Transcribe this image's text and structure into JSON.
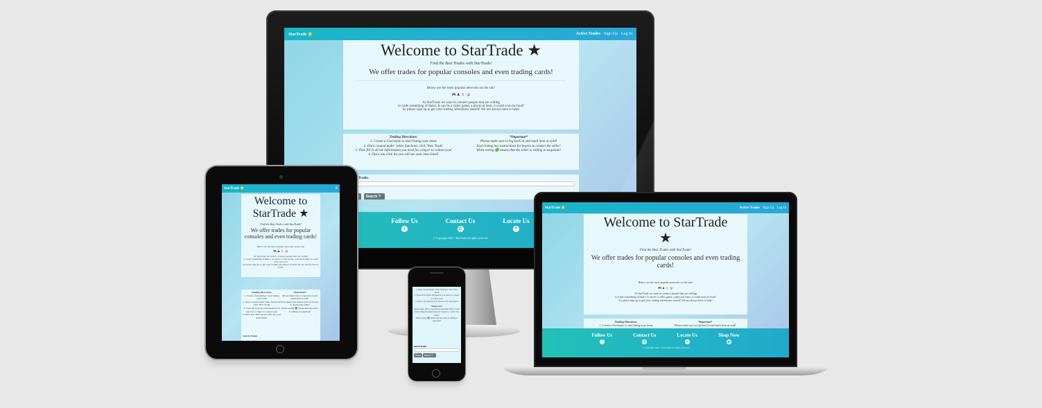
{
  "site": {
    "brand": "StarTrade ⭐",
    "nav": {
      "active_trades": "Active Trades",
      "sign_up": "Sign Up",
      "log_in": "Log In"
    },
    "welcome_title": "Welcome to StarTrade",
    "welcome_star": "★",
    "tagline": "Find the Best Trades with StarTrade!",
    "offer": "We offer trades for popular consoles and even trading cards!",
    "networks_intro": "Below are the most popular networks on the site!",
    "network_icons": "🎮 ♟ 🃏 🎲",
    "about_line1": "At StarTrade we want to connect people that are willing",
    "about_line2": "to trade something of theirs. It can be a video game, a physical item, it could even be food!",
    "about_line3": "So please sign up to get your trading adventures started! We are always here to help!",
    "directions": {
      "title": "Trading Directions:",
      "step1": "1. Create a Username to start listing your items",
      "step2": "2. Once created under 'seller functions' click 'New Trade'",
      "step3": "3. Then fill in all the information you need for a buyer to contact you!",
      "step4": "4. Once you click list you will see your item listed!"
    },
    "important": {
      "title": "*Important*",
      "line1": "Please make sure to log back in and mark item as sold!",
      "line2": "Each listing has instructions for buyers to contact the seller!",
      "line3": "When seeing 🟢 means that the seller is willing to negotiate!"
    },
    "search": {
      "label": "Search Trades",
      "reset_button": "Reset",
      "search_button": "Search 🔍"
    },
    "footer": {
      "follow_us": "Follow Us",
      "contact_us": "Contact Us",
      "locate_us": "Locate Us",
      "shop_now": "Shop Now",
      "follow_icon": "f",
      "contact_icon": "✆",
      "locate_icon": "⌖",
      "shop_icon": "◉",
      "copyright": "© Copyright 2022 - StarTrade All rights reserved"
    }
  },
  "colors": {
    "page_background": "#e8e8e8",
    "nav_gradient_start": "#1ab6c6",
    "nav_gradient_end": "#2aa7d8",
    "footer_gradient_start": "#23c0b8",
    "footer_gradient_end": "#22a9cd",
    "button": "#6c757d"
  }
}
